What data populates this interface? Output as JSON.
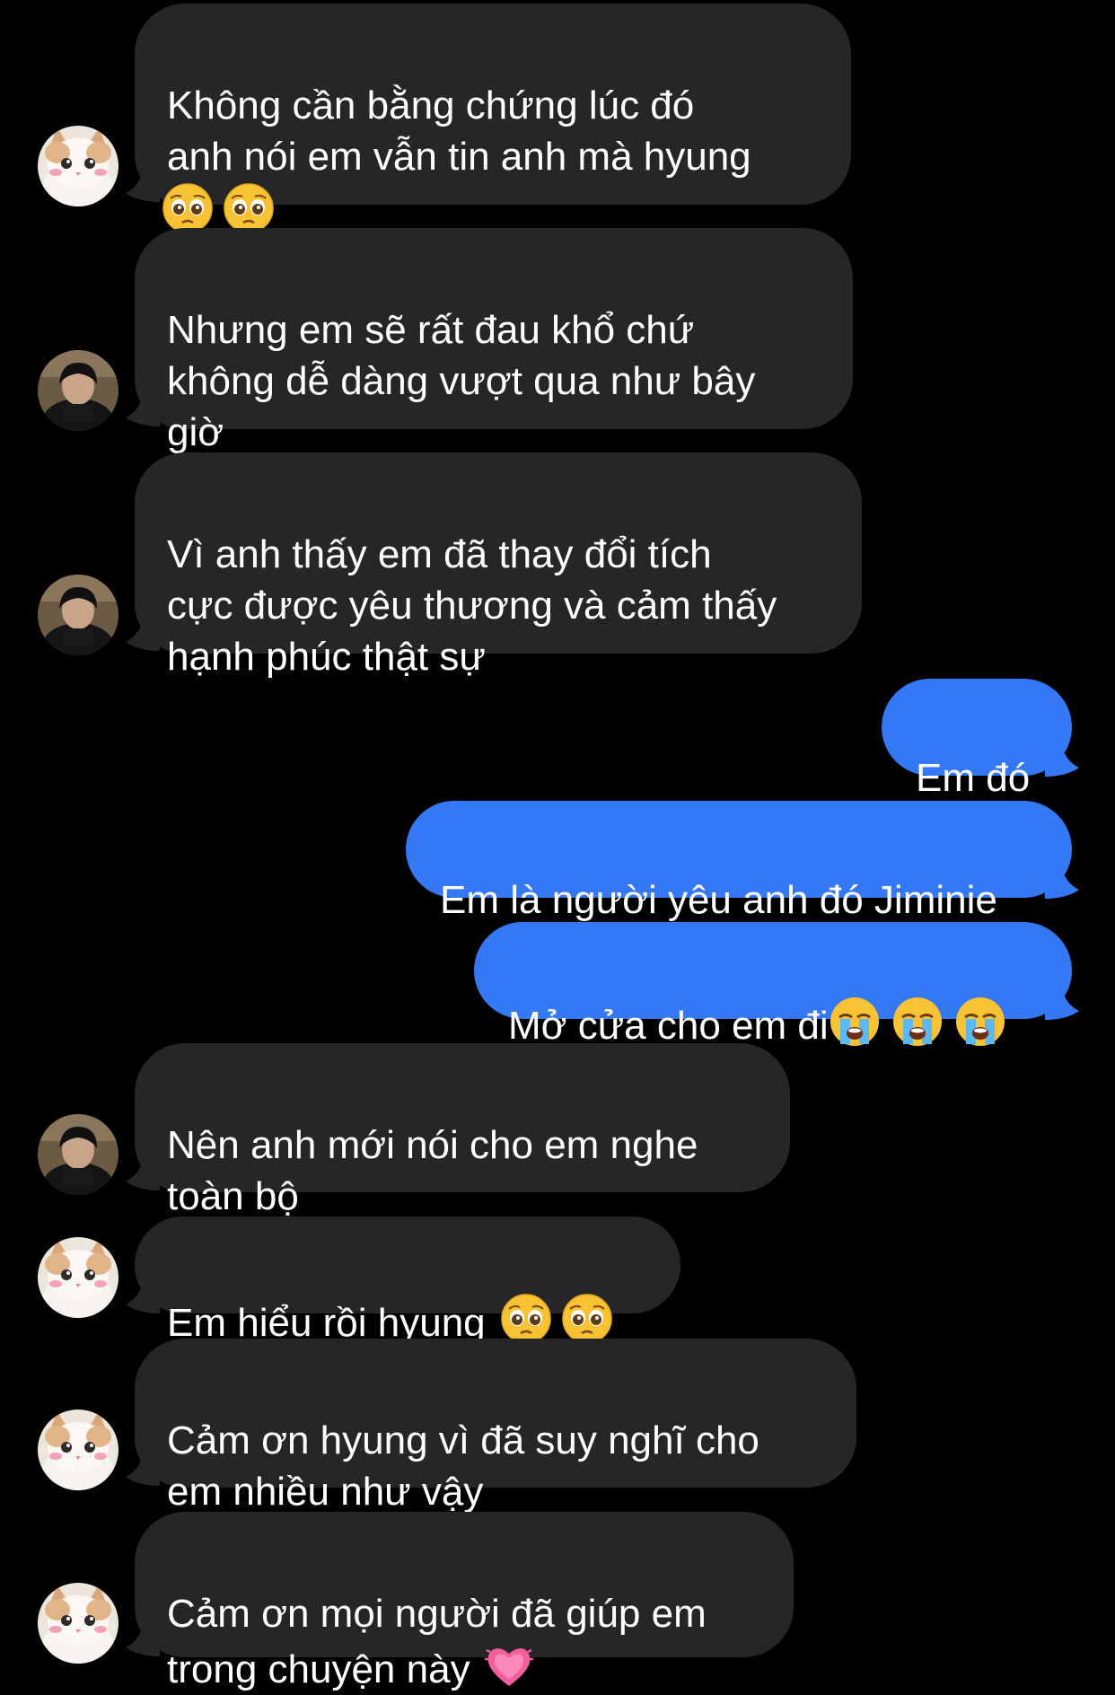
{
  "colors": {
    "background": "#000000",
    "incoming_bubble": "#262628",
    "outgoing_bubble": "#3478f6",
    "text": "#ffffff"
  },
  "messages": [
    {
      "direction": "incoming",
      "avatar": "cat-avatar",
      "text": "Không cần bằng chứng lúc đó\nanh nói em vẫn tin anh mà hyung\n",
      "emojis": [
        "pleading-face-emoji",
        "pleading-face-emoji"
      ]
    },
    {
      "direction": "incoming",
      "avatar": "person-avatar",
      "text": "Nhưng em sẽ rất đau khổ chứ\nkhông dễ dàng vượt qua như bây\ngiờ",
      "emojis": []
    },
    {
      "direction": "incoming",
      "avatar": "person-avatar",
      "text": "Vì anh thấy em đã thay đổi tích\ncực được yêu thương và cảm thấy\nhạnh phúc thật sự",
      "emojis": []
    },
    {
      "direction": "outgoing",
      "text": "Em đó",
      "emojis": []
    },
    {
      "direction": "outgoing",
      "text": "Em là người yêu anh đó Jiminie",
      "emojis": []
    },
    {
      "direction": "outgoing",
      "text": "Mở cửa cho em đi",
      "emojis": [
        "loudly-crying-face-emoji",
        "loudly-crying-face-emoji",
        "loudly-crying-face-emoji"
      ]
    },
    {
      "direction": "incoming",
      "avatar": "person-avatar",
      "text": "Nên anh mới nói cho em nghe\ntoàn bộ",
      "emojis": []
    },
    {
      "direction": "incoming",
      "avatar": "cat-avatar",
      "text": "Em hiểu rồi hyung ",
      "emojis": [
        "pleading-face-emoji",
        "pleading-face-emoji"
      ]
    },
    {
      "direction": "incoming",
      "avatar": "cat-avatar",
      "text": "Cảm ơn hyung vì đã suy nghĩ cho\nem nhiều như vậy",
      "emojis": []
    },
    {
      "direction": "incoming",
      "avatar": "cat-avatar",
      "text": "Cảm ơn mọi người đã giúp em\ntrong chuyện này ",
      "emojis": [
        "growing-heart-emoji"
      ]
    }
  ]
}
